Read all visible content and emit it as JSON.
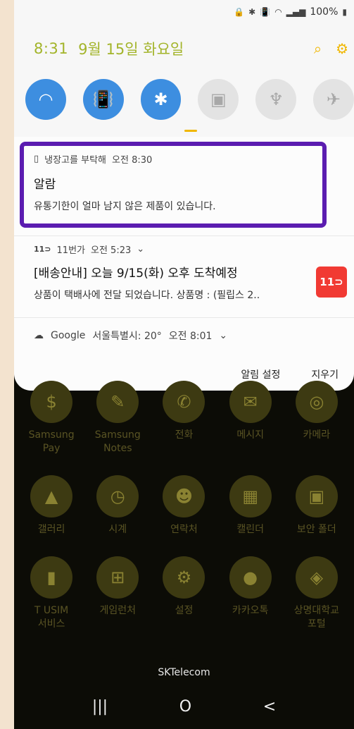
{
  "status_bar": {
    "icons": [
      "lock-icon",
      "bluetooth-icon",
      "vibrate-icon",
      "wifi-icon",
      "signal-icon"
    ],
    "battery": "100%"
  },
  "quick_panel": {
    "time": "8:31",
    "date": "9월 15일 화요일",
    "toggles": [
      {
        "name": "wifi",
        "state": "on",
        "icon": "wifi-icon"
      },
      {
        "name": "sound",
        "state": "on",
        "icon": "vibrate-icon"
      },
      {
        "name": "bluetooth",
        "state": "on",
        "icon": "bluetooth-icon"
      },
      {
        "name": "screen-lock",
        "state": "off",
        "icon": "lock-screen-icon"
      },
      {
        "name": "flashlight",
        "state": "off",
        "icon": "flashlight-icon"
      },
      {
        "name": "airplane",
        "state": "off",
        "icon": "airplane-icon"
      }
    ]
  },
  "notifications": [
    {
      "app": "냉장고를 부탁해",
      "time": "오전 8:30",
      "title": "알람",
      "body": "유통기한이 얼마 남지 않은 제품이 있습니다."
    },
    {
      "app": "11번가",
      "time": "오전 5:23",
      "title": "[배송안내] 오늘 9/15(화) 오후 도착예정",
      "body": "상품이 택배사에 전달 되었습니다. 상품명 : (필립스 2..",
      "badge": "11⊃"
    },
    {
      "app": "Google",
      "detail": "서울특별시: 20°",
      "time": "오전 8:01"
    }
  ],
  "actions": {
    "settings": "알림 설정",
    "clear": "지우기"
  },
  "home_apps": [
    [
      {
        "label": "Samsung\nPay",
        "icon": "samsung-pay-icon"
      },
      {
        "label": "Samsung\nNotes",
        "icon": "samsung-notes-icon"
      },
      {
        "label": "전화",
        "icon": "phone-icon"
      },
      {
        "label": "메시지",
        "icon": "message-icon"
      },
      {
        "label": "카메라",
        "icon": "camera-icon"
      }
    ],
    [
      {
        "label": "갤러리",
        "icon": "gallery-icon"
      },
      {
        "label": "시계",
        "icon": "clock-icon"
      },
      {
        "label": "연락처",
        "icon": "contacts-icon"
      },
      {
        "label": "캘린더",
        "icon": "calendar-icon"
      },
      {
        "label": "보안 폴더",
        "icon": "secure-folder-icon"
      }
    ],
    [
      {
        "label": "T USIM\n서비스",
        "icon": "usim-icon"
      },
      {
        "label": "게임런처",
        "icon": "game-launcher-icon"
      },
      {
        "label": "설정",
        "icon": "settings-icon"
      },
      {
        "label": "카카오톡",
        "icon": "kakaotalk-icon"
      },
      {
        "label": "상명대학교\n포털",
        "icon": "university-icon"
      }
    ]
  ],
  "carrier": "SKTelecom",
  "nav_bar": {
    "recents": "|||",
    "home": "O",
    "back": "<"
  }
}
